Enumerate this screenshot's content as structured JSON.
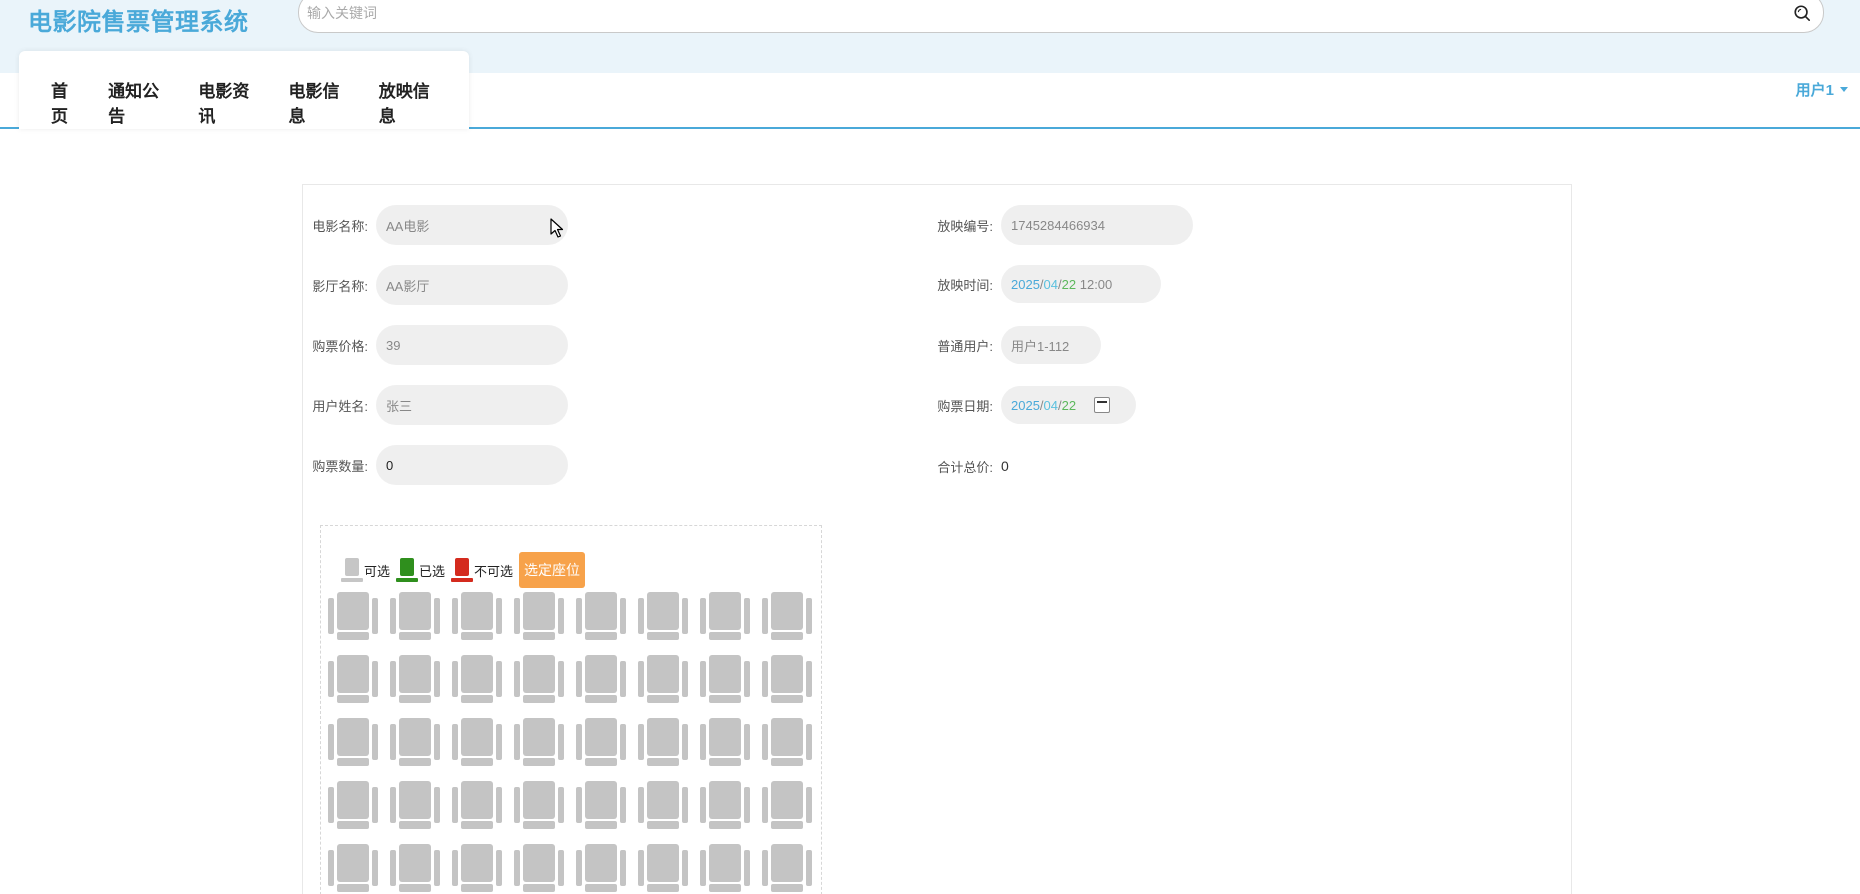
{
  "header": {
    "brand": "电影院售票管理系统",
    "search_placeholder": "输入关键词"
  },
  "nav": {
    "items": [
      "首页",
      "通知公告",
      "电影资讯",
      "电影信息",
      "放映信息"
    ],
    "user": "用户1"
  },
  "form": {
    "left": [
      {
        "label": "电影名称:",
        "value": "AA电影"
      },
      {
        "label": "影厅名称:",
        "value": "AA影厅"
      },
      {
        "label": "购票价格:",
        "value": "39"
      },
      {
        "label": "用户姓名:",
        "value": "张三"
      },
      {
        "label": "购票数量:",
        "value": "0"
      }
    ],
    "right": {
      "screening_no": {
        "label": "放映编号:",
        "value": "1745284466934"
      },
      "screening_time": {
        "label": "放映时间:",
        "year": "2025",
        "month": "04",
        "day": "22",
        "time": "12:00",
        "sep": "/"
      },
      "user": {
        "label": "普通用户:",
        "value": "用户1-112"
      },
      "purchase_date": {
        "label": "购票日期:",
        "year": "2025",
        "month": "04",
        "day": "22",
        "sep": "/"
      },
      "total": {
        "label": "合计总价:",
        "value": "0"
      }
    }
  },
  "seat_map": {
    "legend": {
      "available": "可选",
      "selected": "已选",
      "unavailable": "不可选"
    },
    "choose_button": "选定座位",
    "rows": 5,
    "cols": 8,
    "colors": {
      "available": "#c4c4c4",
      "selected": "#2f8f1d",
      "unavailable": "#d42b1e",
      "button": "#f7a24a"
    }
  },
  "colors": {
    "accent": "#4aa9d9",
    "topbar_bg": "#eaf4fa"
  }
}
